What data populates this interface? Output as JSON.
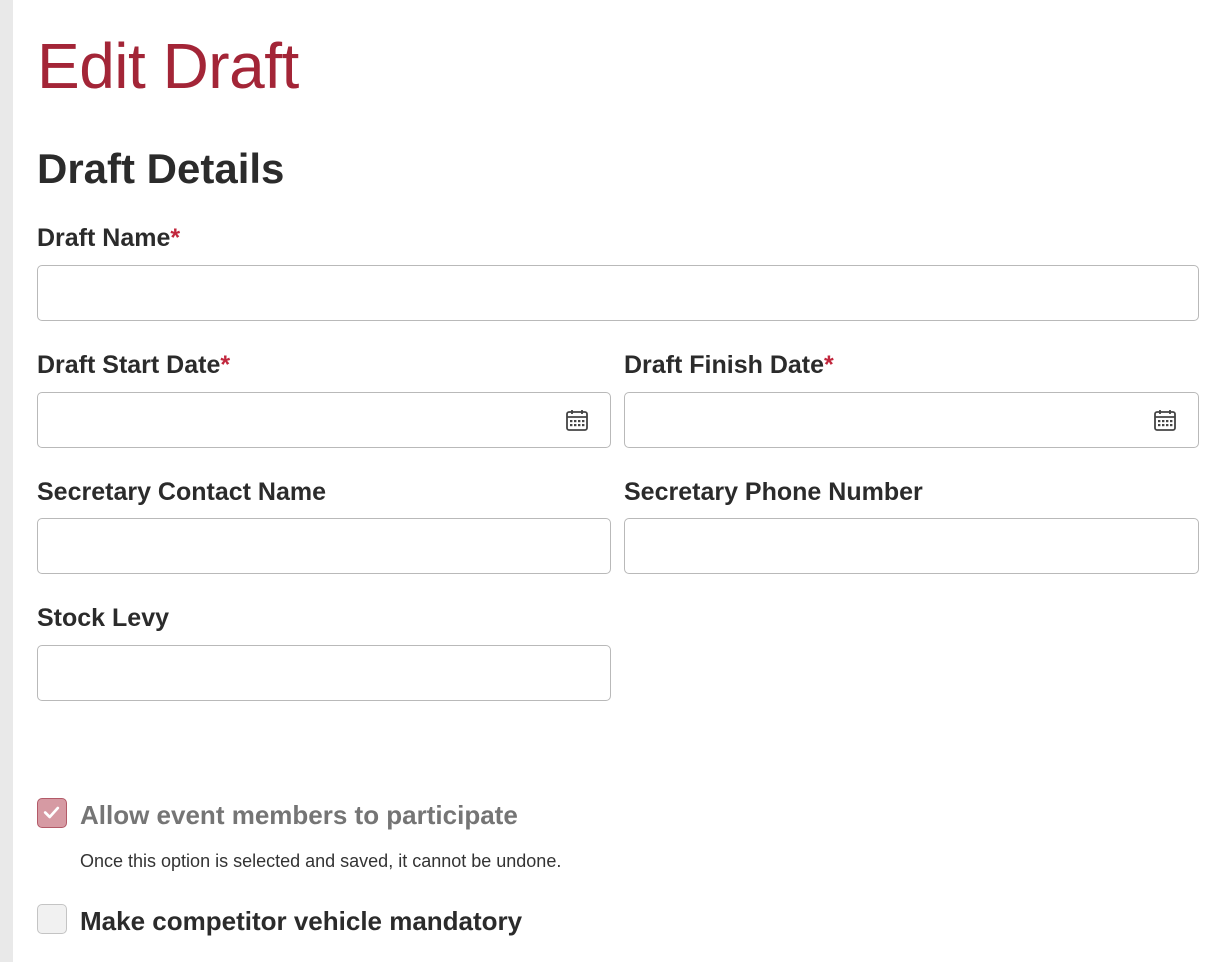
{
  "page": {
    "title": "Edit Draft",
    "section_title": "Draft Details"
  },
  "form": {
    "draft_name": {
      "label": "Draft Name",
      "required_mark": "*",
      "value": ""
    },
    "start_date": {
      "label": "Draft Start Date",
      "required_mark": "*",
      "value": "",
      "icon": "calendar-icon"
    },
    "finish_date": {
      "label": "Draft Finish Date",
      "required_mark": "*",
      "value": "",
      "icon": "calendar-icon"
    },
    "secretary_name": {
      "label": "Secretary Contact Name",
      "value": ""
    },
    "secretary_phone": {
      "label": "Secretary Phone Number",
      "value": ""
    },
    "stock_levy": {
      "label": "Stock Levy",
      "value": ""
    }
  },
  "options": {
    "allow_members": {
      "label": "Allow event members to participate",
      "checked": true,
      "disabled": true,
      "helper": "Once this option is selected and saved, it cannot be undone."
    },
    "vehicle_mandatory": {
      "label": "Make competitor vehicle mandatory",
      "checked": false
    }
  },
  "colors": {
    "title": "#a32537",
    "required": "#c1273d",
    "checkbox_checked": "#d69aa3"
  }
}
